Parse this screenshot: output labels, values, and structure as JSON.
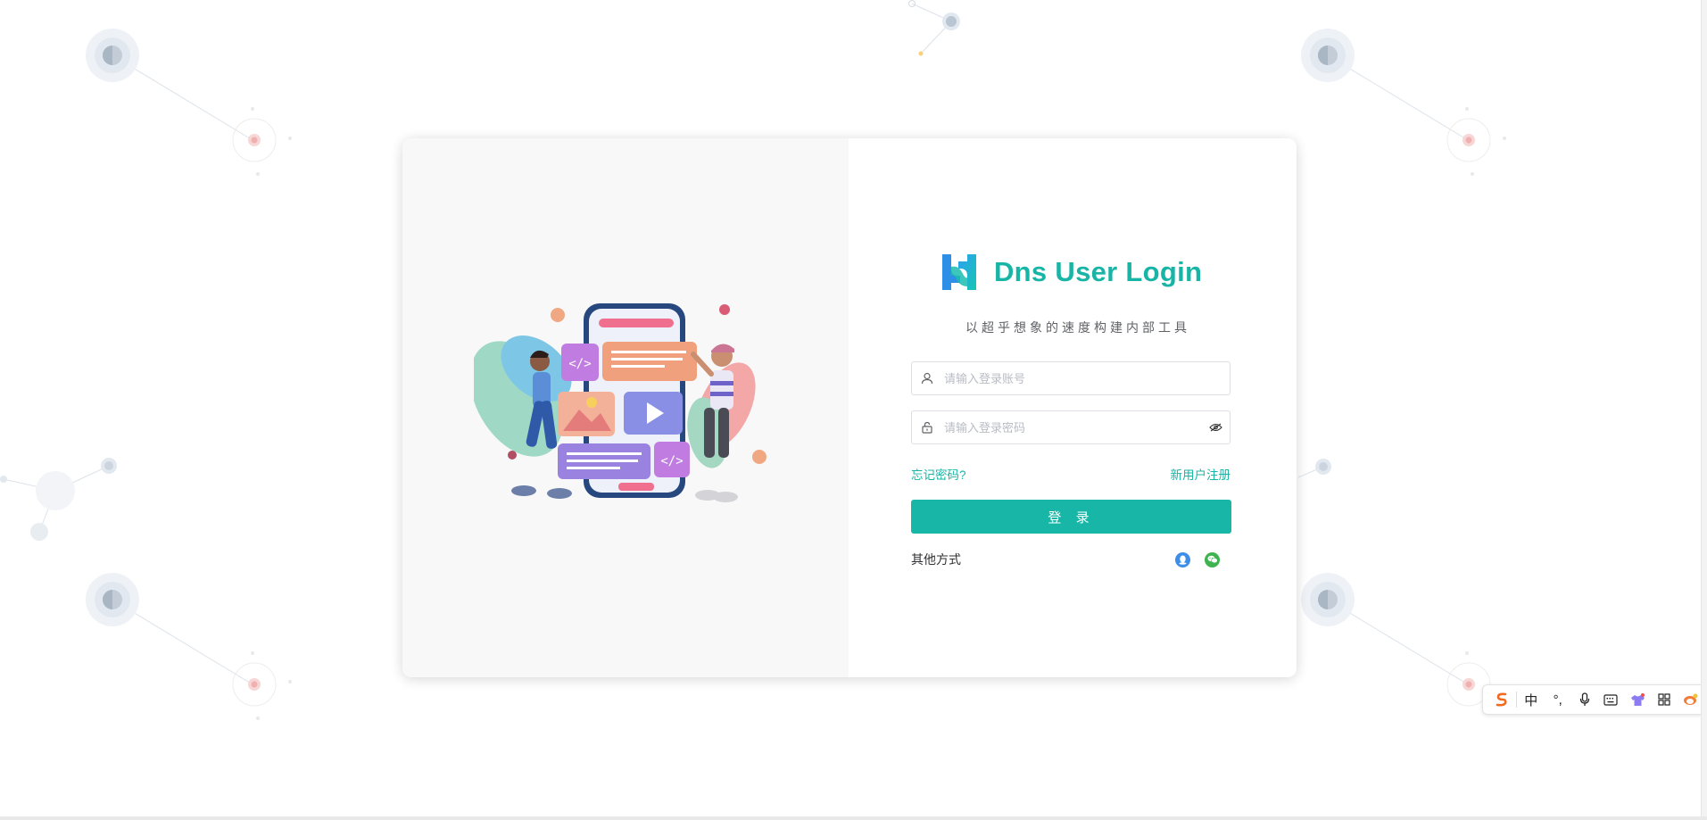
{
  "brand": {
    "title": "Dns User Login",
    "logo_icon": "brand-logo-icon",
    "accent_color": "#18b5a6"
  },
  "subtitle": "以超乎想象的速度构建内部工具",
  "form": {
    "username_placeholder": "请输入登录账号",
    "password_placeholder": "请输入登录密码",
    "forgot_password": "忘记密码?",
    "register": "新用户注册",
    "login_button": "登 录",
    "other_methods_label": "其他方式"
  },
  "icons": {
    "user": "user-icon",
    "lock": "lock-icon",
    "eye": "eye-toggle-icon",
    "qq": "qq-icon",
    "wechat": "wechat-icon"
  },
  "ime_toolbar": {
    "mode_label": "中",
    "punct_label": "°,"
  }
}
